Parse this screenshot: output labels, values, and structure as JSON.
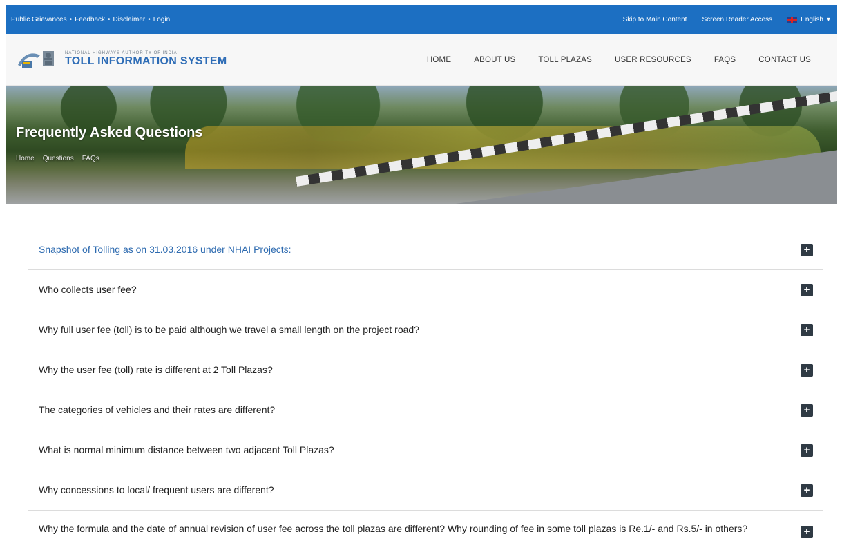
{
  "topbar": {
    "left_links": [
      "Public Grievances",
      "Feedback",
      "Disclaimer",
      "Login"
    ],
    "separator": "•",
    "skip_link": "Skip to Main Content",
    "screen_reader": "Screen Reader Access",
    "language": "English",
    "background_color": "#1c6fc2"
  },
  "header": {
    "logo_small": "NATIONAL HIGHWAYS AUTHORITY OF INDIA",
    "logo_big": "TOLL INFORMATION SYSTEM",
    "nav": [
      "HOME",
      "ABOUT US",
      "TOLL PLAZAS",
      "USER RESOURCES",
      "FAQS",
      "CONTACT US"
    ]
  },
  "hero": {
    "title": "Frequently Asked Questions",
    "breadcrumbs": [
      "Home",
      "Questions",
      "FAQs"
    ]
  },
  "faq": {
    "accent_color": "#2e6bb0",
    "expand_icon": "+",
    "items": [
      "Snapshot of Tolling as on 31.03.2016 under NHAI Projects:",
      "Who collects user fee?",
      "Why full user fee (toll) is to be paid although we travel a small length on the project road?",
      "Why the user fee (toll) rate is different at 2 Toll Plazas?",
      "The categories of vehicles and their rates are different?",
      "What is normal minimum distance between two adjacent Toll Plazas?",
      "Why concessions to local/ frequent users are different?",
      "Why the formula and the date of annual revision of user fee across the toll plazas are different? Why rounding of fee in some toll plazas is Re.1/- and Rs.5/- in others?"
    ]
  }
}
